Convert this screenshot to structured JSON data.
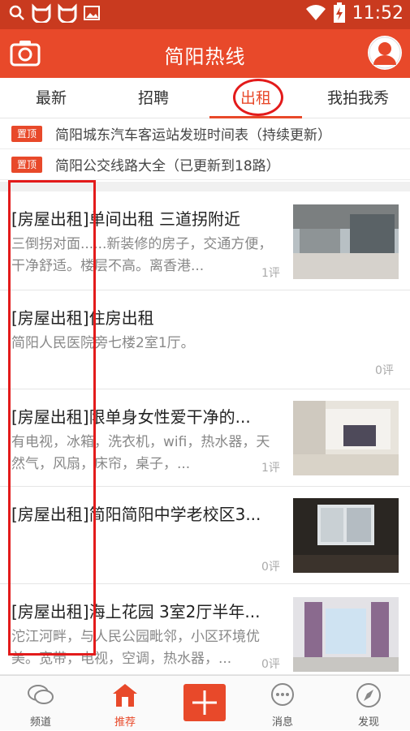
{
  "status_bar": {
    "time": "11:52"
  },
  "header": {
    "title": "简阳热线"
  },
  "tabs": [
    {
      "label": "最新"
    },
    {
      "label": "招聘"
    },
    {
      "label": "出租"
    },
    {
      "label": "我拍我秀"
    }
  ],
  "pinned": [
    {
      "tag": "置顶",
      "text": "简阳城东汽车客运站发班时间表（持续更新）"
    },
    {
      "tag": "置顶",
      "text": "简阳公交线路大全（已更新到18路）"
    }
  ],
  "posts": [
    {
      "title": "[房屋出租]单间出租 三道拐附近",
      "desc": "三倒拐对面......新装修的房子，交通方便，干净舒适。楼层不高。离香港...",
      "comments": "1评"
    },
    {
      "title": "[房屋出租]住房出租",
      "desc": "简阳人民医院旁七楼2室1厅。",
      "comments": "0评"
    },
    {
      "title": "[房屋出租]限单身女性爱干净的...",
      "desc": "有电视，冰箱，洗衣机，wifi，热水器，天然气，风扇，床帘，桌子，...",
      "comments": "1评"
    },
    {
      "title": "[房屋出租]简阳简阳中学老校区3...",
      "desc": "",
      "comments": "0评"
    },
    {
      "title": "[房屋出租]海上花园 3室2厅半年...",
      "desc": "沱江河畔，与人民公园毗邻，小区环境优美。宽带，电视，空调，热水器，...",
      "comments": "0评"
    }
  ],
  "bottom_nav": [
    {
      "label": "频道",
      "icon": "chat-bubbles-icon"
    },
    {
      "label": "推荐",
      "icon": "home-icon"
    },
    {
      "label": "",
      "icon": "plus-icon"
    },
    {
      "label": "消息",
      "icon": "message-icon"
    },
    {
      "label": "发现",
      "icon": "compass-icon"
    }
  ],
  "colors": {
    "brand": "#e8492a",
    "status_bar": "#c93a1f",
    "annotation": "#e31b1b"
  }
}
